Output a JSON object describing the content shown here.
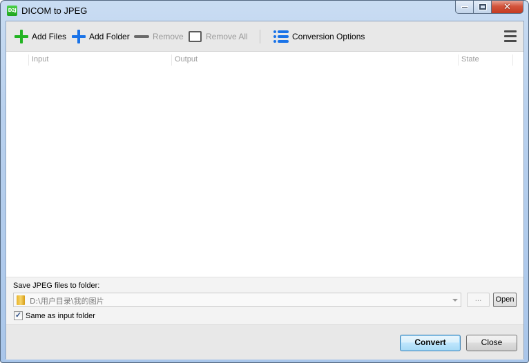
{
  "window": {
    "title": "DICOM to JPEG",
    "app_icon_text": "D2J",
    "caption": {
      "minimize": "minimize",
      "maximize": "maximize",
      "close": "close"
    }
  },
  "toolbar": {
    "add_files": "Add Files",
    "add_folder": "Add Folder",
    "remove": "Remove",
    "remove_all": "Remove All",
    "conversion_options": "Conversion Options",
    "colors": {
      "add_files": "#22b422",
      "add_folder": "#1a73e8",
      "options": "#1a73e8"
    }
  },
  "grid": {
    "columns": [
      "Input",
      "Output",
      "State"
    ],
    "rows": []
  },
  "output": {
    "label": "Save JPEG files to folder:",
    "path": "D:\\用户目录\\我的图片",
    "browse_label": "...",
    "open_label": "Open",
    "same_as_input_label": "Same as input folder",
    "same_as_input_checked": true,
    "check_glyph": "✓"
  },
  "footer": {
    "convert_label": "Convert",
    "close_label": "Close"
  }
}
